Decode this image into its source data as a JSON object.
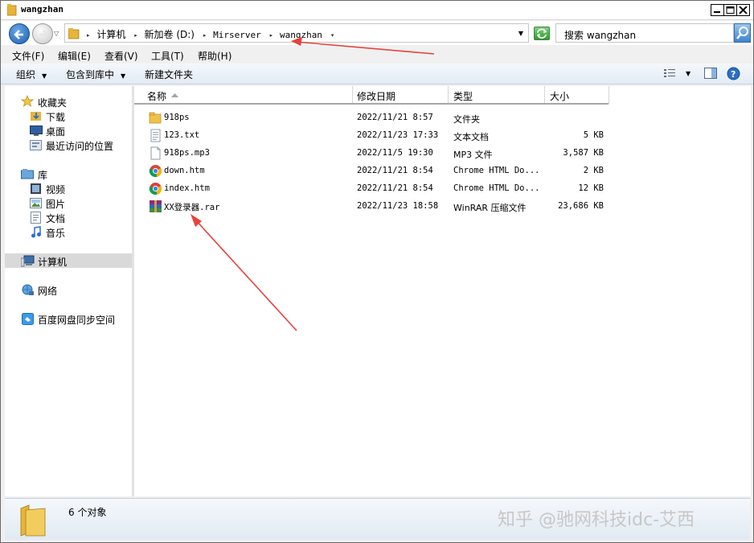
{
  "window": {
    "title": "wangzhan"
  },
  "address": {
    "crumbs": [
      {
        "label": "计算机",
        "mono": false
      },
      {
        "label": "新加卷 (D:)",
        "mono": false
      },
      {
        "label": "Mirserver",
        "mono": true
      },
      {
        "label": "wangzhan",
        "mono": true
      }
    ],
    "search_placeholder": "搜索 wangzhan"
  },
  "menu": [
    "文件(F)",
    "编辑(E)",
    "查看(V)",
    "工具(T)",
    "帮助(H)"
  ],
  "toolbar": {
    "organize": "组织",
    "include_library": "包含到库中",
    "new_folder": "新建文件夹"
  },
  "sidebar": {
    "favorites": "收藏夹",
    "favorites_items": [
      "下载",
      "桌面",
      "最近访问的位置"
    ],
    "libraries": "库",
    "library_items": [
      "视频",
      "图片",
      "文档",
      "音乐"
    ],
    "computer": "计算机",
    "network": "网络",
    "baidu": "百度网盘同步空间"
  },
  "columns": {
    "name": "名称",
    "date": "修改日期",
    "type": "类型",
    "size": "大小"
  },
  "files": [
    {
      "name": "918ps",
      "date": "2022/11/21 8:57",
      "type": "文件夹",
      "size": "",
      "icon": "folder-icon"
    },
    {
      "name": "123.txt",
      "date": "2022/11/23 17:33",
      "type": "文本文档",
      "size": "5 KB",
      "icon": "text-file-icon"
    },
    {
      "name": "918ps.mp3",
      "date": "2022/11/5 19:30",
      "type": "MP3 文件",
      "size": "3,587 KB",
      "icon": "blank-file-icon"
    },
    {
      "name": "down.htm",
      "date": "2022/11/21 8:54",
      "type": "Chrome HTML Do...",
      "size": "2 KB",
      "icon": "chrome-icon"
    },
    {
      "name": "index.htm",
      "date": "2022/11/21 8:54",
      "type": "Chrome HTML Do...",
      "size": "12 KB",
      "icon": "chrome-icon"
    },
    {
      "name": "XX登录器.rar",
      "date": "2022/11/23 18:58",
      "type": "WinRAR 压缩文件",
      "size": "23,686 KB",
      "icon": "winrar-icon"
    }
  ],
  "status": {
    "count_text": "6 个对象"
  },
  "watermark": "知乎 @驰网科技idc-艾西",
  "colors": {
    "annotation": "#e8413c",
    "selected": "#d9d9d9",
    "folder": "#f0c24a"
  }
}
